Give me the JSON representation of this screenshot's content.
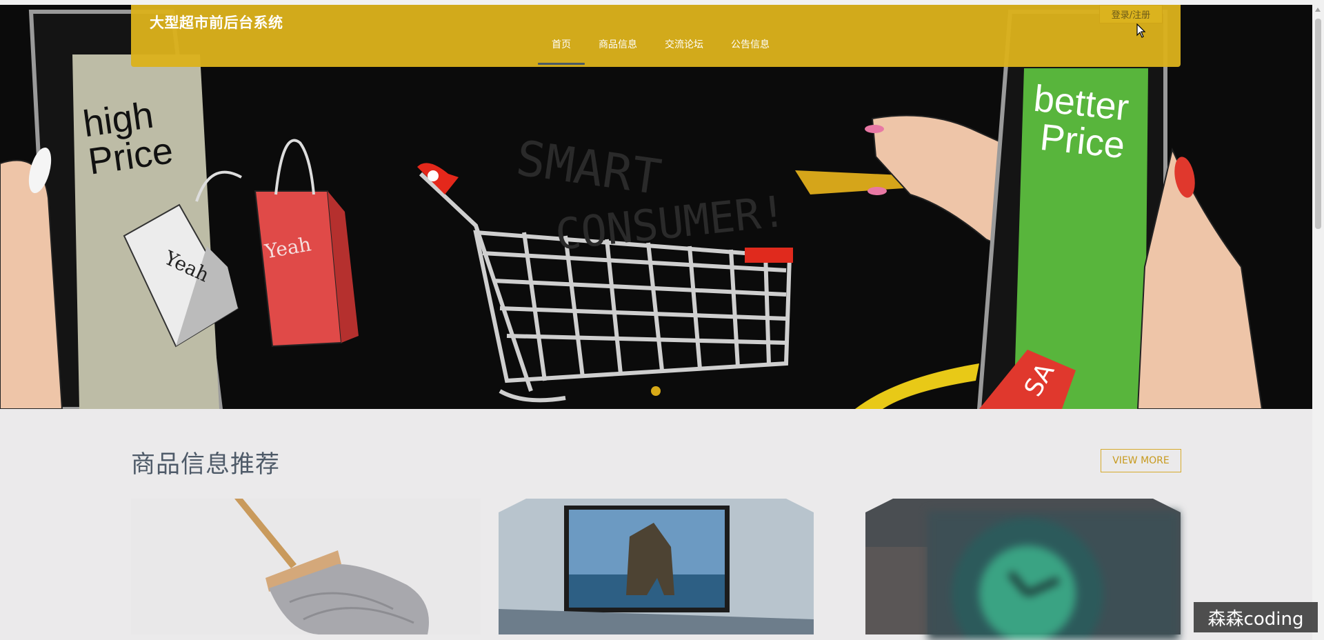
{
  "header": {
    "brand": "大型超市前后台系统",
    "login_label": "登录/注册",
    "nav": [
      {
        "label": "首页",
        "active": true
      },
      {
        "label": "商品信息",
        "active": false
      },
      {
        "label": "交流论坛",
        "active": false
      },
      {
        "label": "公告信息",
        "active": false
      }
    ]
  },
  "hero": {
    "left_screen_text": [
      "high",
      "Price"
    ],
    "right_screen_text": [
      "better",
      "Price"
    ],
    "center_text": [
      "SMART",
      "CONSUMER!"
    ],
    "bag_text": "Yeah",
    "tag_text": "SA",
    "carousel_dots": 1
  },
  "section": {
    "title": "商品信息推荐",
    "view_more_label": "VIEW MORE"
  },
  "products": [
    {
      "icon": "mop-image"
    },
    {
      "icon": "television-image"
    },
    {
      "icon": "watch-image"
    }
  ],
  "watermark": "森森coding",
  "colors": {
    "accent": "#dbb11c",
    "nav_underline": "#4a5a66",
    "view_more": "#c79a1e",
    "green_screen": "#58b53c",
    "red_bag": "#e04a48"
  }
}
